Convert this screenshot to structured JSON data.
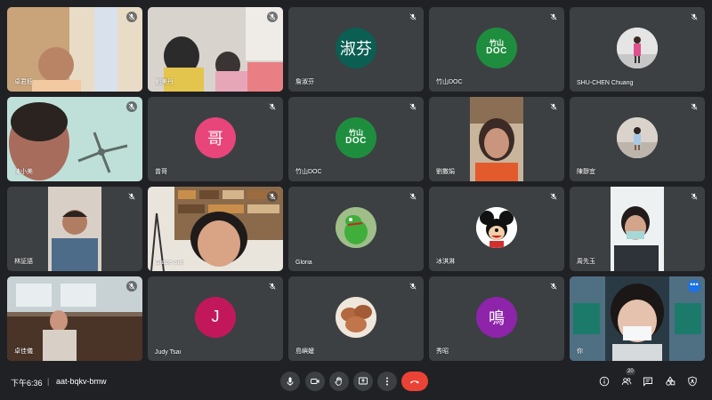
{
  "meeting": {
    "time": "下午6:36",
    "separator": "|",
    "code": "aat-bqkv-bmw",
    "participant_count": "20"
  },
  "tiles": [
    {
      "name": "卓君鈺",
      "kind": "video",
      "icon": "mic-off-icon"
    },
    {
      "name": "劉美丹",
      "kind": "video",
      "icon": "mic-off-icon"
    },
    {
      "name": "詹淑芬",
      "kind": "avatar",
      "avatar_text": "淑芬",
      "avatar_color": "#0b5e52",
      "icon": "mic-off-icon"
    },
    {
      "name": "竹山DOC",
      "kind": "brand",
      "brand_top": "竹山",
      "brand_bottom": "DOC",
      "avatar_color": "#1e8e3e",
      "icon": "mic-off-icon"
    },
    {
      "name": "SHU-CHEN Chuang",
      "kind": "photo",
      "avatar_color": "#d7d7d7",
      "icon": "mic-off-icon"
    },
    {
      "name": "陳小美",
      "kind": "video",
      "icon": "mic-off-icon"
    },
    {
      "name": "曾哥",
      "kind": "avatar",
      "avatar_text": "哥",
      "avatar_color": "#e8457a",
      "icon": "mic-off-icon"
    },
    {
      "name": "竹山DOC",
      "kind": "brand",
      "brand_top": "竹山",
      "brand_bottom": "DOC",
      "avatar_color": "#1e8e3e",
      "icon": "mic-off-icon"
    },
    {
      "name": "劉撒娟",
      "kind": "center-video",
      "icon": "mic-off-icon"
    },
    {
      "name": "陳靜宜",
      "kind": "photo",
      "avatar_color": "#cfc9c2",
      "icon": "mic-off-icon"
    },
    {
      "name": "林証語",
      "kind": "center-video",
      "icon": "mic-off-icon"
    },
    {
      "name": "Grace Sun",
      "kind": "video",
      "icon": "mic-off-icon"
    },
    {
      "name": "Gloria",
      "kind": "photo",
      "avatar_color": "#4caf50",
      "icon": "mic-off-icon"
    },
    {
      "name": "冰淇淋",
      "kind": "photo",
      "avatar_color": "#ffffff",
      "icon": "mic-off-icon"
    },
    {
      "name": "周先玉",
      "kind": "center-video",
      "icon": "mic-off-icon"
    },
    {
      "name": "卓佳儀",
      "kind": "video",
      "icon": "mic-off-icon"
    },
    {
      "name": "Judy Tsai",
      "kind": "avatar",
      "avatar_text": "J",
      "avatar_color": "#c2185b",
      "icon": "mic-off-icon"
    },
    {
      "name": "島嶼嬤",
      "kind": "photo",
      "avatar_color": "#b7795a",
      "icon": "mic-off-icon"
    },
    {
      "name": "秀昭",
      "kind": "avatar",
      "avatar_text": "鳴",
      "avatar_color": "#8e24aa",
      "icon": "mic-off-icon"
    },
    {
      "name": "你",
      "kind": "video",
      "self": true,
      "icon": "more-options-icon"
    }
  ],
  "controls": {
    "center": [
      "mic-icon",
      "camera-icon",
      "raise-hand-icon",
      "present-screen-icon",
      "more-options-icon",
      "end-call-icon"
    ],
    "right": [
      "meeting-info-icon",
      "people-icon",
      "chat-icon",
      "activities-icon",
      "host-controls-icon"
    ]
  },
  "colors": {
    "background": "#202124",
    "tile": "#3c4043",
    "end_call": "#ea4335",
    "accent": "#1a73e8"
  }
}
